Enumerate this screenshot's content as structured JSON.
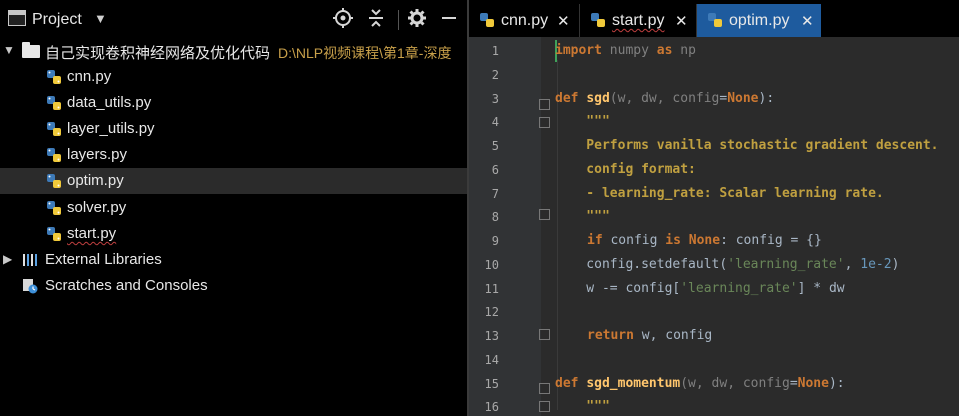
{
  "project_panel": {
    "title": "Project",
    "dropdown_glyph": "▼",
    "icons": [
      "locate-icon",
      "collapse-all-icon",
      "gear-icon",
      "minimize-icon"
    ]
  },
  "tree": {
    "root_label": "自己实现卷积神经网络及优化代码",
    "root_path": "D:\\NLP视频课程\\第1章-深度",
    "files": [
      "cnn.py",
      "data_utils.py",
      "layer_utils.py",
      "layers.py",
      "optim.py",
      "solver.py",
      "start.py"
    ],
    "selected": "optim.py",
    "external_libraries": "External Libraries",
    "scratches": "Scratches and Consoles"
  },
  "tabs": [
    {
      "label": "cnn.py",
      "close": "✕",
      "active": false
    },
    {
      "label": "start.py",
      "close": "✕",
      "active": false
    },
    {
      "label": "optim.py",
      "close": "✕",
      "active": true
    }
  ],
  "editor": {
    "line_numbers": [
      "1",
      "2",
      "3",
      "4",
      "5",
      "6",
      "7",
      "8",
      "9",
      "10",
      "11",
      "12",
      "13",
      "14",
      "15",
      "16"
    ],
    "lines": {
      "l1_import": "import",
      "l1_rest": " numpy ",
      "l1_as": "as",
      "l1_np": " np",
      "l3_def": "def ",
      "l3_name": "sgd",
      "l3_args": "(w, dw, config",
      "l3_eq": "=",
      "l3_none": "None",
      "l3_close": "):",
      "l4": "    \"\"\"",
      "l5": "    Performs vanilla stochastic gradient descent.",
      "l6": "    config format:",
      "l7": "    - learning_rate: Scalar learning rate.",
      "l8": "    \"\"\"",
      "l9_if": "if",
      "l9_a": " config ",
      "l9_is": "is",
      "l9_none": " None",
      "l9_b": ": config = {}",
      "l10_a": "    config.setdefault(",
      "l10_str": "'learning_rate'",
      "l10_b": ", ",
      "l10_num": "1e-2",
      "l10_c": ")",
      "l11_a": "    w -= config[",
      "l11_str": "'learning_rate'",
      "l11_b": "] * dw",
      "l13_ret": "return",
      "l13_rest": " w, config",
      "l15_def": "def ",
      "l15_name": "sgd_momentum",
      "l15_args": "(w, dw, config",
      "l15_eq": "=",
      "l15_none": "None",
      "l15_close": "):",
      "l16": "    \"\"\""
    }
  },
  "colors": {
    "editor_bg": "#2b2b2b",
    "keyword": "#cc7832",
    "function": "#ffc66d",
    "docstring": "#c0a040",
    "string": "#6a8759",
    "number": "#6897bb",
    "active_tab": "#1e5b9e"
  }
}
